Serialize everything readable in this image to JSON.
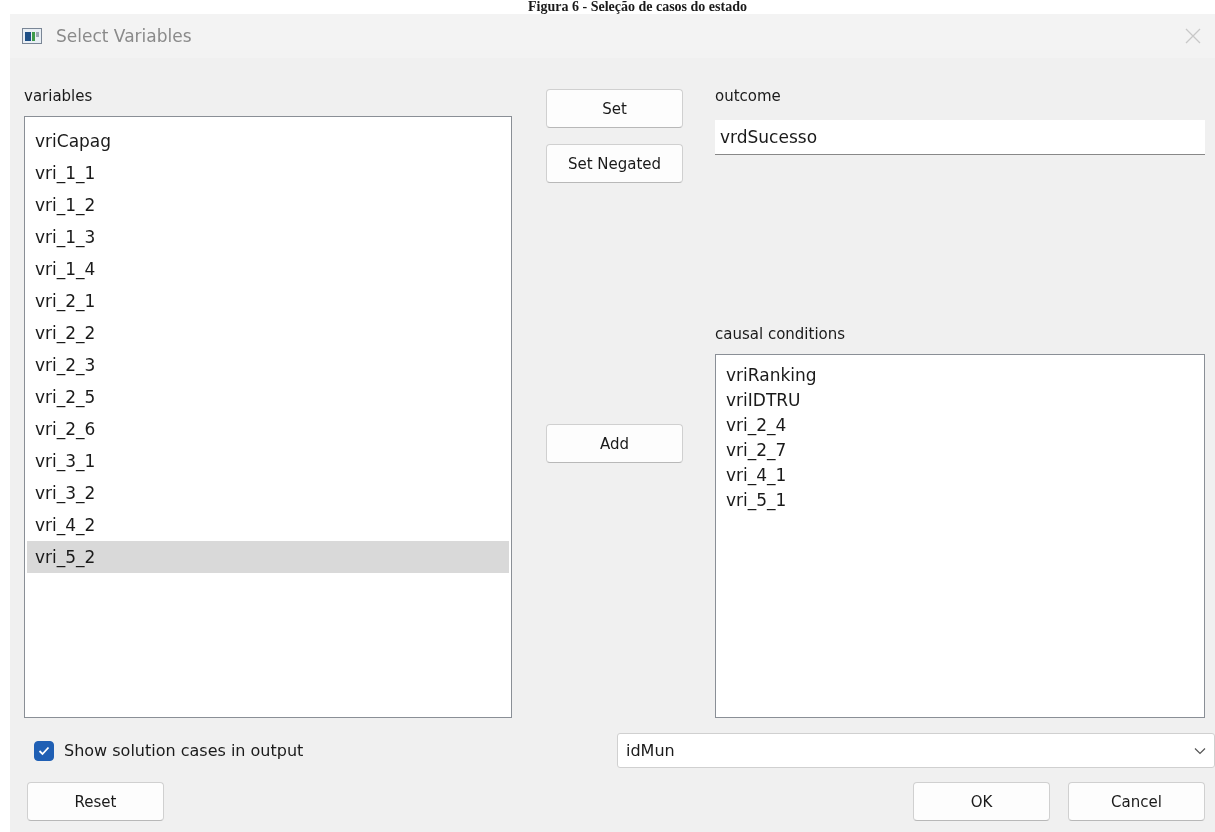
{
  "caption": "Figura 6 - Seleção de casos do estado",
  "window": {
    "title": "Select Variables"
  },
  "variables": {
    "label": "variables",
    "items": [
      {
        "name": "vriCapag",
        "selected": false
      },
      {
        "name": "vri_1_1",
        "selected": false
      },
      {
        "name": "vri_1_2",
        "selected": false
      },
      {
        "name": "vri_1_3",
        "selected": false
      },
      {
        "name": "vri_1_4",
        "selected": false
      },
      {
        "name": "vri_2_1",
        "selected": false
      },
      {
        "name": "vri_2_2",
        "selected": false
      },
      {
        "name": "vri_2_3",
        "selected": false
      },
      {
        "name": "vri_2_5",
        "selected": false
      },
      {
        "name": "vri_2_6",
        "selected": false
      },
      {
        "name": "vri_3_1",
        "selected": false
      },
      {
        "name": "vri_3_2",
        "selected": false
      },
      {
        "name": "vri_4_2",
        "selected": false
      },
      {
        "name": "vri_5_2",
        "selected": true
      }
    ]
  },
  "middle_buttons": {
    "set": "Set",
    "set_negated": "Set Negated",
    "add": "Add"
  },
  "outcome": {
    "label": "outcome",
    "value": "vrdSucesso"
  },
  "causal_conditions": {
    "label": "causal conditions",
    "items": [
      {
        "name": "vriRanking",
        "selected": false
      },
      {
        "name": "vriIDTRU",
        "selected": false
      },
      {
        "name": "vri_2_4",
        "selected": false
      },
      {
        "name": "vri_2_7",
        "selected": false
      },
      {
        "name": "vri_4_1",
        "selected": false
      },
      {
        "name": "vri_5_1",
        "selected": false
      }
    ]
  },
  "show_cases": {
    "label": "Show solution cases in output",
    "checked": true
  },
  "case_id": {
    "value": "idMun"
  },
  "buttons": {
    "reset": "Reset",
    "ok": "OK",
    "cancel": "Cancel"
  }
}
